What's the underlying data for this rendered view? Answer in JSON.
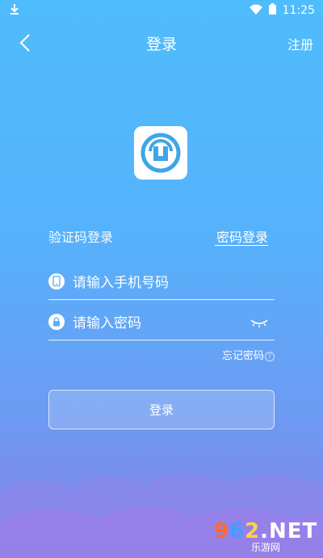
{
  "status_bar": {
    "time": "11:25"
  },
  "nav": {
    "title": "登录",
    "register": "注册"
  },
  "tabs": {
    "sms": "验证码登录",
    "password": "密码登录"
  },
  "fields": {
    "phone_placeholder": "请输入手机号码",
    "password_placeholder": "请输入密码"
  },
  "forgot_password": "忘记密码",
  "login_button": "登录",
  "watermark": {
    "top": "962.NET",
    "bottom": "乐游网"
  },
  "icons": [
    "download-icon",
    "wifi-icon",
    "battery-icon",
    "back-arrow-icon",
    "app-logo-icon",
    "phone-icon",
    "lock-icon",
    "eye-closed-icon"
  ]
}
